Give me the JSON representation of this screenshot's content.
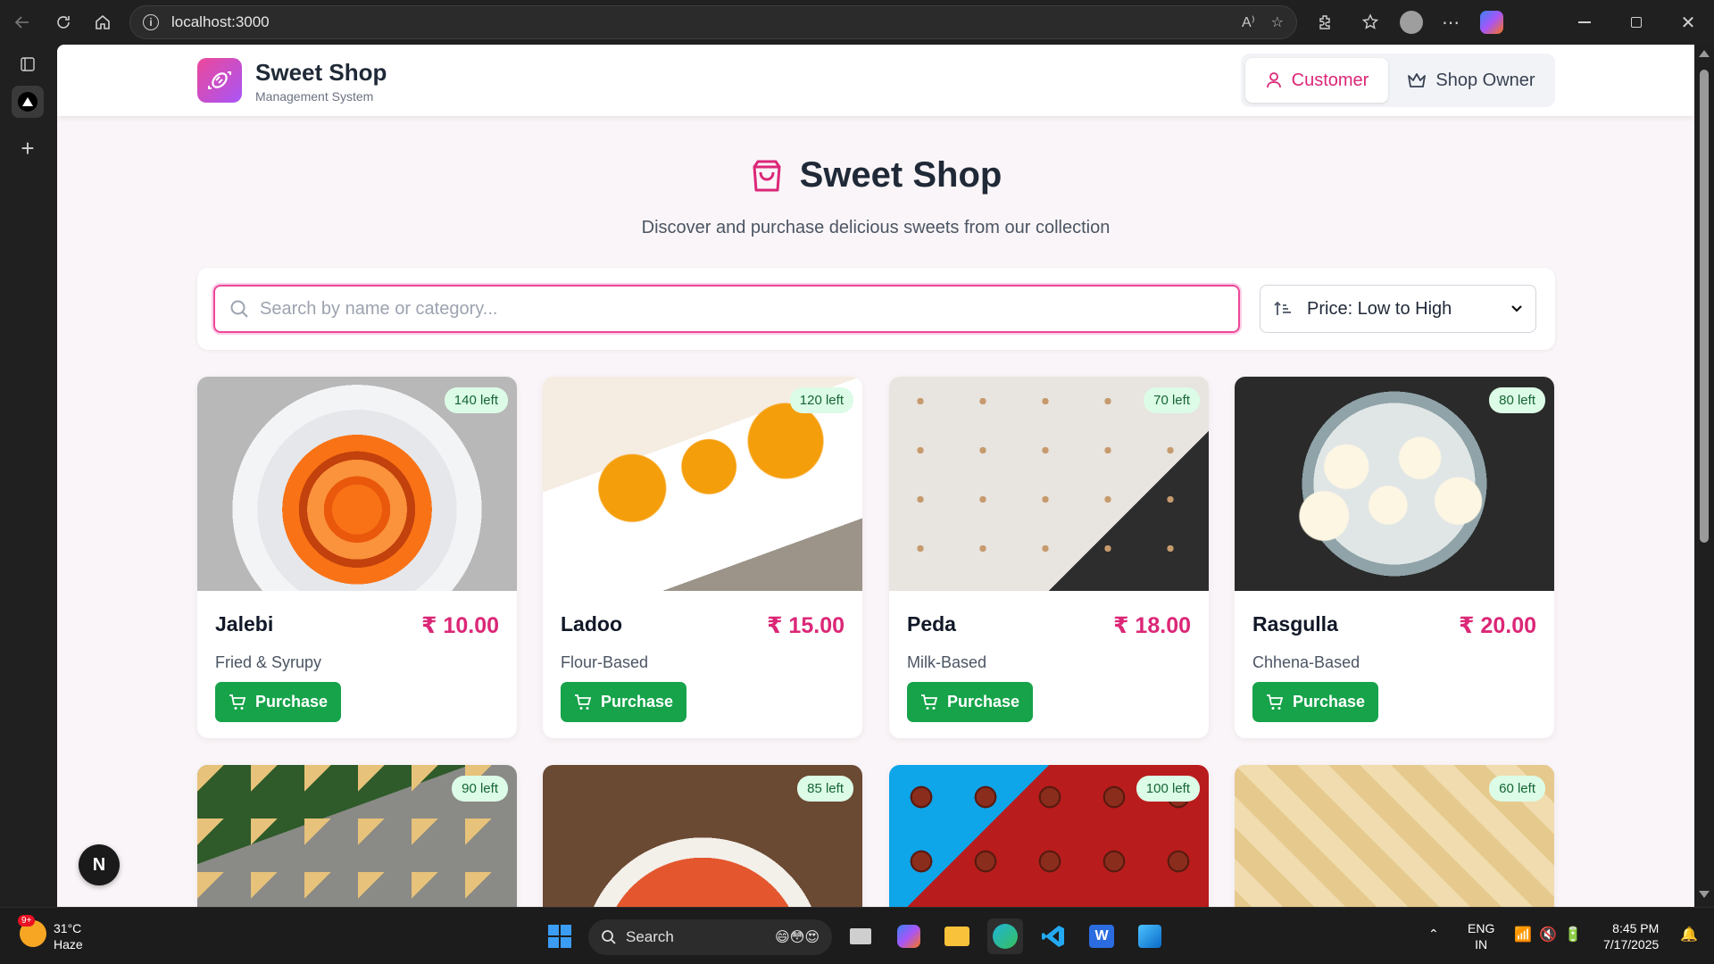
{
  "browser": {
    "url": "localhost:3000"
  },
  "header": {
    "brand_title": "Sweet Shop",
    "brand_subtitle": "Management System",
    "roles": [
      {
        "label": "Customer",
        "active": true
      },
      {
        "label": "Shop Owner",
        "active": false
      }
    ]
  },
  "hero": {
    "title": "Sweet Shop",
    "subtitle": "Discover and purchase delicious sweets from our collection"
  },
  "filters": {
    "search_placeholder": "Search by name or category...",
    "sort_selected": "Price: Low to High"
  },
  "currency_symbol": "₹",
  "purchase_label": "Purchase",
  "sweets": [
    {
      "name": "Jalebi",
      "price": "₹ 10.00",
      "category": "Fried & Syrupy",
      "stock": "140 left"
    },
    {
      "name": "Ladoo",
      "price": "₹ 15.00",
      "category": "Flour-Based",
      "stock": "120 left"
    },
    {
      "name": "Peda",
      "price": "₹ 18.00",
      "category": "Milk-Based",
      "stock": "70 left"
    },
    {
      "name": "Rasgulla",
      "price": "₹ 20.00",
      "category": "Chhena-Based",
      "stock": "80 left"
    },
    {
      "stock": "90 left"
    },
    {
      "stock": "85 left"
    },
    {
      "stock": "100 left"
    },
    {
      "stock": "60 left"
    }
  ],
  "taskbar": {
    "weather_temp": "31°C",
    "weather_desc": "Haze",
    "weather_badge": "9+",
    "search_label": "Search",
    "lang_top": "ENG",
    "lang_bottom": "IN",
    "time": "8:45 PM",
    "date": "7/17/2025"
  },
  "colors": {
    "accent_pink": "#db2777",
    "purchase_green": "#16a34a",
    "stock_badge_bg": "#dcfce7"
  }
}
